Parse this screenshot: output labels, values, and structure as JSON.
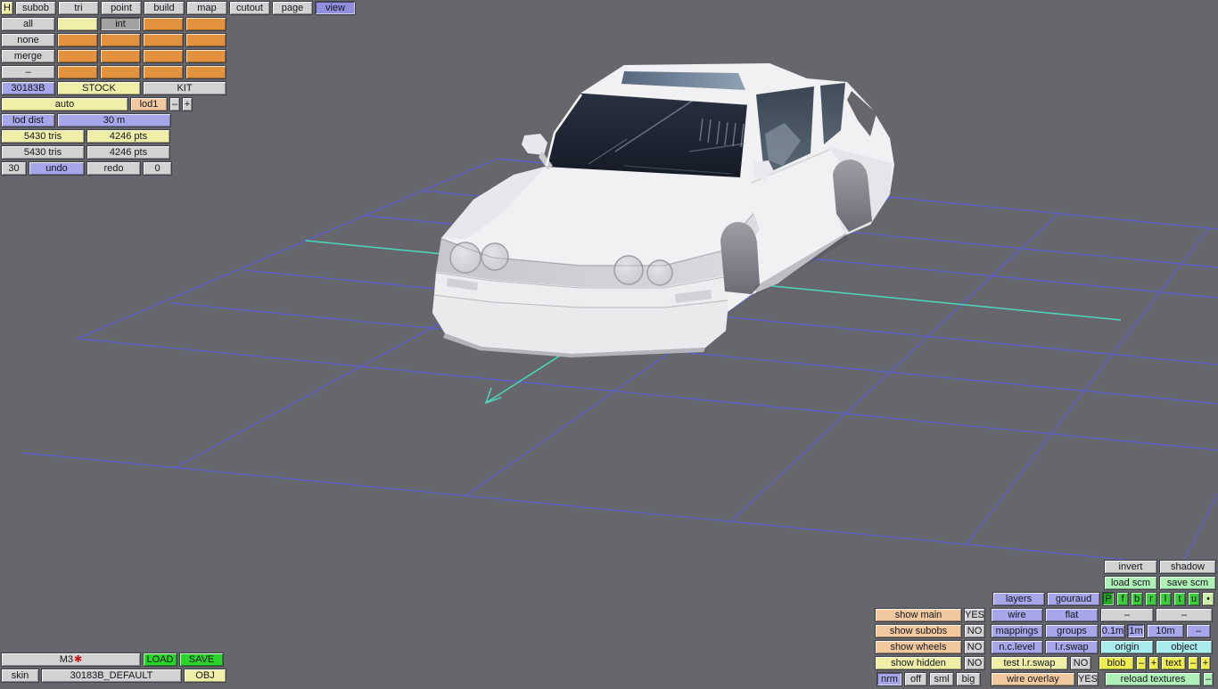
{
  "tabs": [
    "H",
    "subob",
    "tri",
    "point",
    "build",
    "map",
    "cutout",
    "page",
    "view"
  ],
  "left": {
    "all": "all",
    "none": "none",
    "merge": "merge",
    "dash": "–",
    "int": "int",
    "model_id": "30183B",
    "stock": "STOCK",
    "kit": "KIT",
    "auto": "auto",
    "lod1": "lod1",
    "lod_minus": "–",
    "lod_plus": "+",
    "lod_dist": "lod dist",
    "lod_dist_value": "30 m",
    "tris_selected": "5430 tris",
    "pts_selected": "4246 pts",
    "tris_total": "5430 tris",
    "pts_total": "4246 pts",
    "undo_count": "30",
    "undo": "undo",
    "redo": "redo",
    "redo_count": "0"
  },
  "bottom_left": {
    "model": "M3",
    "modified_star": "✱",
    "load": "LOAD",
    "save": "SAVE",
    "skin": "skin",
    "skin_name": "30183B_DEFAULT",
    "obj": "OBJ"
  },
  "bottom_right": {
    "invert": "invert",
    "shadow": "shadow",
    "load_scm": "load scm",
    "save_scm": "save scm",
    "layers": "layers",
    "gouraud": "gouraud",
    "proj": [
      "P",
      "f",
      "b",
      "r",
      "l",
      "t",
      "u",
      "•"
    ],
    "show_main": "show main",
    "show_main_val": "YES",
    "wire": "wire",
    "flat": "flat",
    "dash1": "–",
    "dash2": "–",
    "show_subobs": "show subobs",
    "show_subobs_val": "NO",
    "mappings": "mappings",
    "groups": "groups",
    "m01": "0.1m",
    "m1": "1m",
    "m10": "10m",
    "mdash": "–",
    "show_wheels": "show wheels",
    "show_wheels_val": "NO",
    "nclevel": "n.c.level",
    "lrswap": "l.r.swap",
    "origin": "origin",
    "object": "object",
    "show_hidden": "show hidden",
    "show_hidden_val": "NO",
    "test_lrswap": "test l.r.swap",
    "test_lrswap_val": "NO",
    "blob": "blob",
    "blob_minus": "–",
    "blob_plus": "+",
    "text": "text",
    "text_minus": "–",
    "text_plus": "+",
    "nrm": "nrm",
    "off": "off",
    "sml": "sml",
    "big": "big",
    "wire_overlay": "wire overlay",
    "wire_overlay_val": "YES",
    "reload_textures": "reload textures",
    "reload_dash": "–"
  },
  "colors": {
    "viewport_bg": "#66666d",
    "grid_blue": "#5f5fe0",
    "grid_cyan": "#4ad8ba",
    "accent_orange": "#e2913d",
    "accent_purple": "#a6a6e8",
    "accent_green": "#2ad42a",
    "accent_mint": "#aef0b6",
    "accent_tan": "#f2c89e",
    "accent_yellow": "#efefa8"
  }
}
